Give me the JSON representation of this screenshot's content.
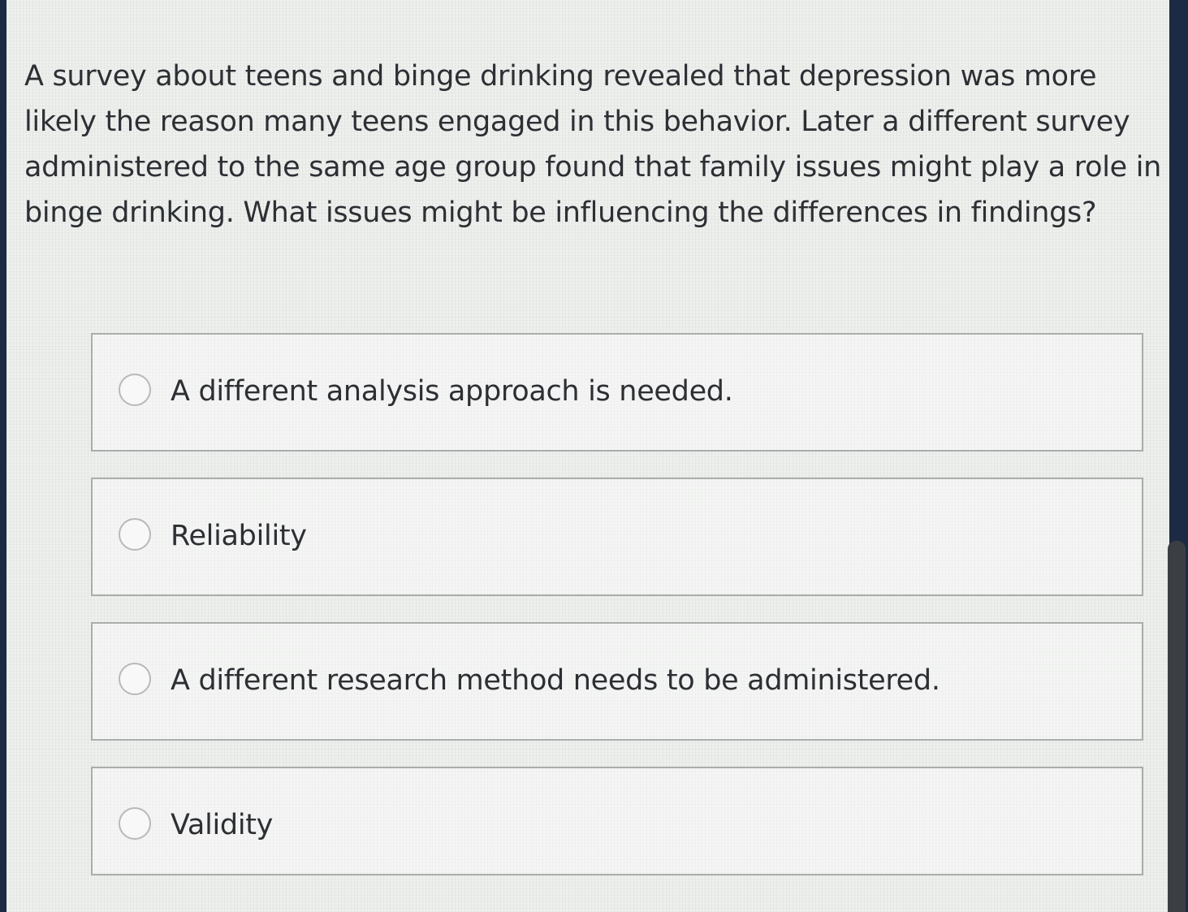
{
  "question": {
    "text": "A survey about teens and binge drinking revealed that depression was more likely the reason many teens engaged in this behavior. Later a different survey administered to the same age group found that family issues might play a role in binge drinking. What issues might be influencing the differences in findings?"
  },
  "options": [
    {
      "label": "A different analysis approach is needed.",
      "selected": false
    },
    {
      "label": "Reliability",
      "selected": false
    },
    {
      "label": "A different research method needs to be administered.",
      "selected": false
    },
    {
      "label": "Validity",
      "selected": false
    }
  ],
  "colors": {
    "text": "#2c2f33",
    "border": "#a9adac",
    "background": "#eef0ee",
    "frame": "#1c2a44"
  },
  "icons": {
    "radio": "radio-unchecked-icon"
  }
}
